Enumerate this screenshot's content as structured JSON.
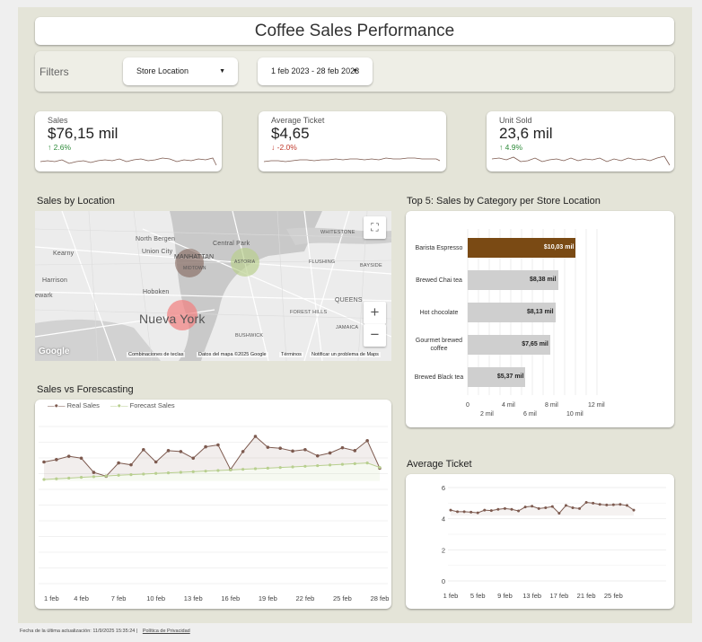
{
  "title": "Coffee Sales Performance",
  "filters": {
    "label": "Filters",
    "store_location": "Store Location",
    "date_range": "1 feb 2023 - 28 feb 2023"
  },
  "kpis": [
    {
      "label": "Sales",
      "value": "$76,15 mil",
      "change": "2.6%",
      "direction": "up"
    },
    {
      "label": "Average Ticket",
      "value": "$4,65",
      "change": "-2.0%",
      "direction": "down"
    },
    {
      "label": "Unit Sold",
      "value": "23,6 mil",
      "change": "4.9%",
      "direction": "up"
    }
  ],
  "map": {
    "title": "Sales by Location",
    "labels": [
      "North Bergen",
      "Union City",
      "Central Park",
      "MANHATTAN",
      "MIDTOWN",
      "ASTORIA",
      "Hoboken",
      "Nueva York",
      "Kearny",
      "Harrison",
      "ewark",
      "WHITESTONE",
      "FLUSHING",
      "BAYSIDE",
      "QUEENS",
      "FOREST HILLS",
      "JAMAICA",
      "BUSHWICK"
    ],
    "attribution": [
      "Combinaciones de teclas",
      "Datos del mapa ©2025 Google",
      "Términos",
      "Notificar un problema de Maps"
    ],
    "logo": "Google",
    "zoom_in": "+",
    "zoom_out": "−",
    "colors": {
      "manhattan": "#7a5a4e",
      "astoria": "#b9cf8a",
      "nueva_york": "#f27f7f"
    }
  },
  "category_chart": {
    "title": "Top 5: Sales by Category per Store Location",
    "x_ticks_top": [
      "0",
      "4 mil",
      "8 mil",
      "12 mil"
    ],
    "x_ticks_bottom": [
      "2 mil",
      "6 mil",
      "10 mil"
    ]
  },
  "forecast_chart": {
    "title": "Sales vs Forescasting",
    "x_ticks": [
      "1 feb",
      "4 feb",
      "7 feb",
      "10 feb",
      "13 feb",
      "16 feb",
      "19 feb",
      "22 feb",
      "25 feb",
      "28 feb"
    ]
  },
  "avg_ticket_chart": {
    "title": "Average Ticket",
    "y_ticks": [
      "6",
      "4",
      "2",
      "0"
    ],
    "x_ticks": [
      "1 feb",
      "5 feb",
      "9 feb",
      "13 feb",
      "17 feb",
      "21 feb",
      "25 feb"
    ]
  },
  "footer": {
    "updated": "Fecha de la última actualización: 11/9/2025 15:35:24",
    "privacy": "Política de Privacidad"
  },
  "chart_data": [
    {
      "type": "bar",
      "title": "Top 5: Sales by Category per Store Location",
      "categories": [
        "Barista Espresso",
        "Brewed Chai tea",
        "Hot chocolate",
        "Gourmet brewed coffee",
        "Brewed Black tea"
      ],
      "values": [
        10030,
        8380,
        8130,
        7650,
        5370
      ],
      "labels": [
        "$10,03 mil",
        "$8,38 mil",
        "$8,13 mil",
        "$7,65 mil",
        "$5,37 mil"
      ],
      "xlim": [
        0,
        14000
      ],
      "highlight_color": "#7a4a14",
      "bar_color": "#cfcfcf"
    },
    {
      "type": "line",
      "title": "Sales vs Forescasting",
      "x": [
        1,
        2,
        3,
        4,
        5,
        6,
        7,
        8,
        9,
        10,
        11,
        12,
        13,
        14,
        15,
        16,
        17,
        18,
        19,
        20,
        21,
        22,
        23,
        24,
        25,
        26,
        27,
        28
      ],
      "series": [
        {
          "name": "Real Sales",
          "color": "#7d5a4f",
          "values": [
            2700,
            2750,
            2820,
            2780,
            2480,
            2400,
            2680,
            2640,
            2960,
            2700,
            2940,
            2920,
            2780,
            3020,
            3060,
            2540,
            2920,
            3240,
            3010,
            2990,
            2930,
            2960,
            2830,
            2890,
            3000,
            2940,
            3150,
            2570
          ]
        },
        {
          "name": "Forecast Sales",
          "color": "#b8cf8f",
          "values": [
            2330,
            2345,
            2360,
            2375,
            2390,
            2405,
            2420,
            2432,
            2445,
            2458,
            2470,
            2482,
            2495,
            2507,
            2520,
            2532,
            2545,
            2558,
            2570,
            2583,
            2596,
            2609,
            2623,
            2636,
            2650,
            2664,
            2678,
            2585
          ]
        }
      ],
      "ylim": [
        0,
        3600
      ]
    },
    {
      "type": "line",
      "title": "Average Ticket",
      "x": [
        1,
        2,
        3,
        4,
        5,
        6,
        7,
        8,
        9,
        10,
        11,
        12,
        13,
        14,
        15,
        16,
        17,
        18,
        19,
        20,
        21,
        22,
        23,
        24,
        25,
        26,
        27,
        28
      ],
      "series": [
        {
          "name": "Average Ticket",
          "color": "#7d5a4f",
          "values": [
            4.55,
            4.45,
            4.45,
            4.42,
            4.38,
            4.55,
            4.52,
            4.6,
            4.65,
            4.6,
            4.5,
            4.75,
            4.8,
            4.65,
            4.7,
            4.78,
            4.35,
            4.85,
            4.7,
            4.65,
            5.05,
            5.0,
            4.92,
            4.88,
            4.9,
            4.92,
            4.85,
            4.55
          ]
        }
      ],
      "ylim": [
        0,
        6
      ]
    }
  ]
}
